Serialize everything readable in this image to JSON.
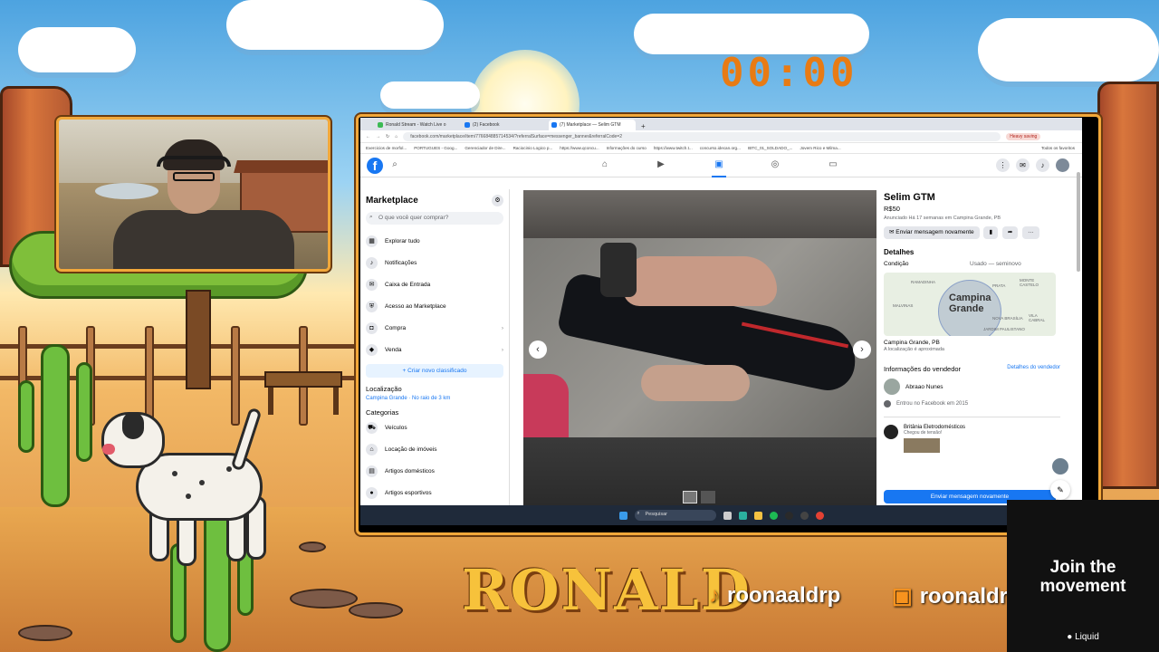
{
  "stream": {
    "timer": "00:00",
    "brand": "RONALD",
    "socials": [
      {
        "icon": "tiktok-icon",
        "handle": "roonaaldrp"
      },
      {
        "icon": "twitch-icon",
        "handle": "roonaldrp"
      }
    ],
    "ad": {
      "headline_1": "Join the",
      "headline_2": "movement",
      "brand": "Liquid"
    }
  },
  "browser": {
    "tabs": [
      {
        "title": "Ronald Stream - Watch Live o",
        "active": false
      },
      {
        "title": "(2) Facebook",
        "active": false
      },
      {
        "title": "(7) Marketplace — Selim GTM",
        "active": true
      }
    ],
    "url": "facebook.com/marketplace/item/776684885714534/?referralSurface=messenger_banner&referralCode=2",
    "paused_label": "Heavy saving",
    "bookmarks": [
      "Exercicios de morfol...",
      "PORTUGUES - Goog...",
      "Gerenciador de Dire...",
      "Raciocinio Logico p...",
      "https://www.qconcu...",
      "Informações do curso",
      "https://www.twitch.t...",
      "concurso.idecan.org...",
      "IBTC_01_SOLDADO_...",
      "Jovem Rico e Milma...",
      "Todos os favoritos"
    ]
  },
  "marketplace": {
    "title": "Marketplace",
    "search_placeholder": "O que você quer comprar?",
    "menu": [
      {
        "label": "Explorar tudo",
        "icon": "store-icon"
      },
      {
        "label": "Notificações",
        "icon": "bell-icon"
      },
      {
        "label": "Caixa de Entrada",
        "icon": "inbox-icon"
      },
      {
        "label": "Acesso ao Marketplace",
        "icon": "shield-icon"
      },
      {
        "label": "Compra",
        "icon": "bag-icon"
      },
      {
        "label": "Venda",
        "icon": "tag-icon"
      }
    ],
    "create_button": "+ Criar novo classificado",
    "location_heading": "Localização",
    "location_value": "Campina Grande · No raio de 3 km",
    "categories_heading": "Categorias",
    "categories": [
      "Veículos",
      "Locação de imóveis",
      "Artigos domésticos",
      "Artigos esportivos"
    ]
  },
  "listing": {
    "title": "Selim GTM",
    "price": "R$50",
    "posted": "Anunciado Há 17 semanas em Campina Grande, PB",
    "message_button": "Enviar mensagem novamente",
    "details_heading": "Detalhes",
    "condition_label": "Condição",
    "condition_value": "Usado — seminovo",
    "map_city": "Campina Grande",
    "map_labels": [
      "RAMADINHA",
      "PRATA",
      "MONTE CASTELO",
      "MALVINAS",
      "NOVA BRASÍLIA",
      "VILA CABRAL",
      "JARDIM PAULISTANO"
    ],
    "location_text": "Campina Grande, PB",
    "location_note": "A localização é aproximada",
    "seller_heading": "Informações do vendedor",
    "seller_link": "Detalhes do vendedor",
    "seller_name": "Abraao Nunes",
    "seller_joined": "Entrou no Facebook em 2015",
    "ad_name": "Britânia Eletrodomésticos",
    "ad_sub": "Chegou de tensão!",
    "bottom_button": "Enviar mensagem novamente"
  },
  "taskbar": {
    "search_placeholder": "Pesquisar"
  },
  "colors": {
    "accent": "#f2a83a",
    "facebook_blue": "#1877f2",
    "timer": "#e87b14",
    "brand": "#f7c23b"
  }
}
